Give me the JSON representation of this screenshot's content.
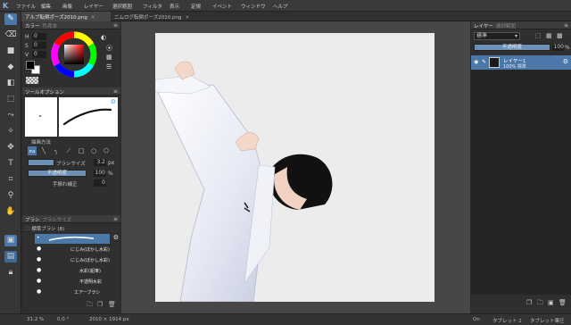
{
  "menubar": {
    "items": [
      "ファイル",
      "編集",
      "画像",
      "レイヤー",
      "選択範囲",
      "フィルタ",
      "表示",
      "定規",
      "イベント",
      "ウィンドウ",
      "ヘルプ"
    ]
  },
  "tabs": [
    {
      "label": "アルブ転倒ポーズ2010.png",
      "active": true
    },
    {
      "label": "二ムログ転倒ポーズ2010.png",
      "active": false
    }
  ],
  "color_panel": {
    "tab_active": "カラー",
    "tab_inactive": "色見本",
    "h_label": "H",
    "s_label": "S",
    "v_label": "V",
    "h_value": "0",
    "s_value": "0",
    "v_value": "0",
    "fg_color": "#000000",
    "bg_color": "#ffffff"
  },
  "tool_option": {
    "title": "ツールオプション",
    "drawing_method_label": "描画方法",
    "brush_size_label": "ブラシサイズ",
    "brush_size_value": "3.2",
    "brush_size_unit": "px",
    "opacity_label": "不透明度",
    "opacity_value": "100",
    "opacity_unit": "%",
    "stabilizer_label": "手振れ補正",
    "stabilizer_value": "0"
  },
  "brush_panel": {
    "tab_active": "ブラシ",
    "tab_inactive": "ブラシサイズ",
    "group_label": "標準ブラシ (8)",
    "brushes": [
      "ペン",
      "にじみ(ぼかし水彩)",
      "にじみ(ぼかし水彩)",
      "水彩(鉛筆)",
      "不透明水彩",
      "エアーブラシ"
    ]
  },
  "layer_panel": {
    "tab_active": "レイヤー",
    "tab_inactive": "選択範囲",
    "blend_mode": "標準",
    "opacity_label": "不透明度",
    "opacity_value": "100",
    "opacity_unit": "%",
    "layer_name": "レイヤー1",
    "layer_info": "100% 標準"
  },
  "status": {
    "zoom": "31.2 %",
    "angle": "0.0 °",
    "size": "2010 × 1914 px",
    "on": "On",
    "tablet": "タブレット 2",
    "tablet_pressure": "タブレット筆圧"
  },
  "colors": {
    "accent": "#4b78a8",
    "panel_bg": "#2f2f2f",
    "canvas_bg": "#ececec"
  }
}
